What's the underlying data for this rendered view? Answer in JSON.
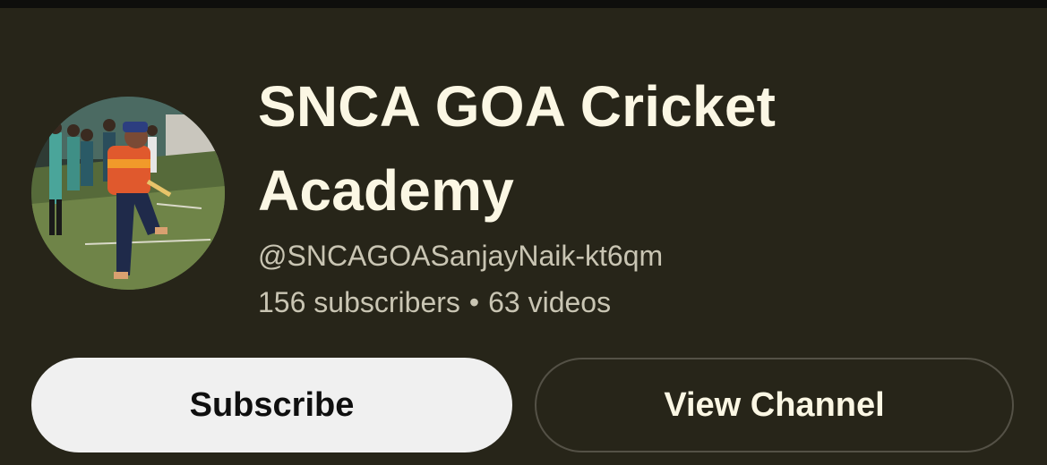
{
  "channel": {
    "title": "SNCA GOA Cricket Academy",
    "handle": "@SNCAGOASanjayNaik-kt6qm",
    "subscribers": "156 subscribers",
    "separator": "•",
    "videos": "63 videos"
  },
  "actions": {
    "subscribe_label": "Subscribe",
    "view_channel_label": "View Channel"
  },
  "colors": {
    "background": "#272519",
    "title_text": "#fbf7e4",
    "meta_text": "#c9c5b3",
    "subscribe_bg": "#f0f0f0",
    "view_border": "#545146"
  }
}
